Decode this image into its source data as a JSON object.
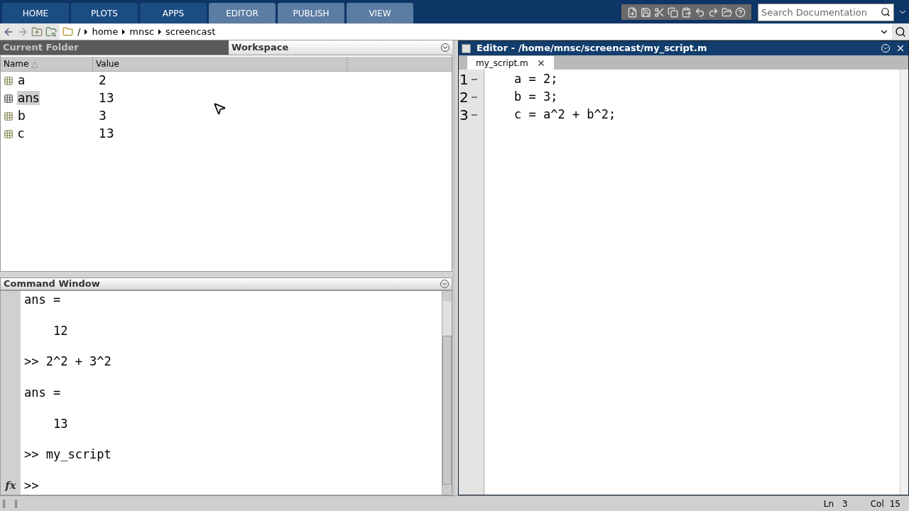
{
  "toolstrip": {
    "tabs": [
      {
        "label": "HOME",
        "kind": "global"
      },
      {
        "label": "PLOTS",
        "kind": "global"
      },
      {
        "label": "APPS",
        "kind": "global"
      },
      {
        "label": "EDITOR",
        "kind": "contextual"
      },
      {
        "label": "PUBLISH",
        "kind": "contextual"
      },
      {
        "label": "VIEW",
        "kind": "contextual"
      }
    ],
    "search": {
      "placeholder": "Search Documentation"
    }
  },
  "address": {
    "root": "/",
    "parts": [
      "home",
      "mnsc",
      "screencast"
    ]
  },
  "workspace": {
    "inactive_tab": "Current Folder",
    "title": "Workspace",
    "columns": [
      "Name",
      "Value"
    ],
    "sort_mark": "△",
    "rows": [
      {
        "name": "a",
        "value": "2",
        "selected": false
      },
      {
        "name": "ans",
        "value": "13",
        "selected": true
      },
      {
        "name": "b",
        "value": "3",
        "selected": false
      },
      {
        "name": "c",
        "value": "13",
        "selected": false
      }
    ]
  },
  "command_window": {
    "title": "Command Window",
    "lines": [
      "ans =",
      "    12",
      ">> 2^2 + 3^2",
      "ans =",
      "    13",
      ">> my_script"
    ],
    "prompt": ">>",
    "fx": "fx"
  },
  "editor": {
    "title": "Editor - /home/mnsc/screencast/my_script.m",
    "tab": "my_script.m",
    "lines": [
      {
        "number": "1",
        "code": "a = 2;"
      },
      {
        "number": "2",
        "code": "b = 3;"
      },
      {
        "number": "3",
        "code": "c = a^2 + b^2;"
      }
    ]
  },
  "status": {
    "ln_label": "Ln",
    "ln": "3",
    "col_label": "Col",
    "col": "15"
  }
}
